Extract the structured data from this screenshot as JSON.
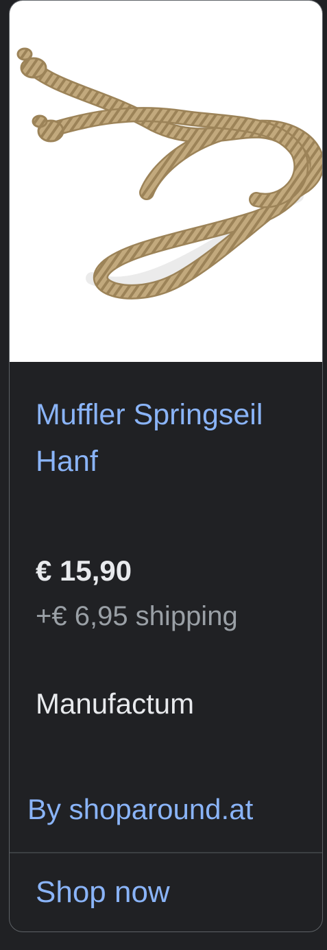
{
  "product": {
    "title": "Muffler Springseil Hanf",
    "price": "€ 15,90",
    "shipping": "+€ 6,95 shipping",
    "merchant": "Manufactum",
    "seller": "By shoparound.at",
    "cta": "Shop now",
    "image_icon": "rope-image"
  },
  "colors": {
    "background": "#202124",
    "link": "#8ab4f8",
    "text": "#e8eaed",
    "muted": "#9aa0a6",
    "border": "#5f6368",
    "rope": "#b49a6e"
  }
}
